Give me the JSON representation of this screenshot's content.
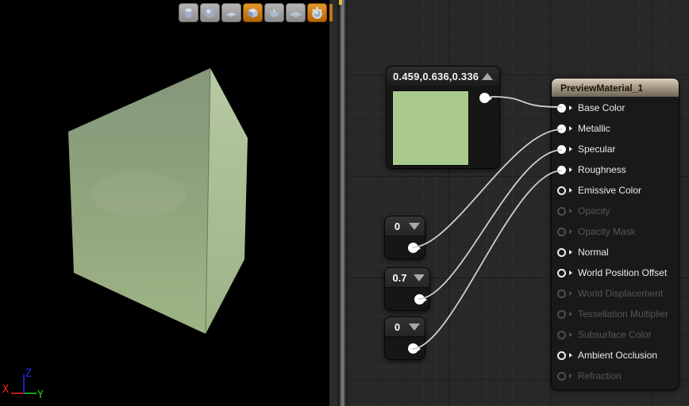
{
  "viewport": {
    "axis_labels": [
      "X",
      "Y",
      "Z"
    ],
    "toolbar": [
      {
        "name": "preview-cylinder-button",
        "icon": "cylinder",
        "active": false
      },
      {
        "name": "preview-sphere-button",
        "icon": "sphere",
        "active": false
      },
      {
        "name": "preview-plane-button",
        "icon": "plane",
        "active": false
      },
      {
        "name": "preview-cube-button",
        "icon": "cube",
        "active": true
      },
      {
        "name": "preview-teapot-button",
        "icon": "teapot",
        "active": false
      },
      {
        "name": "preview-grid-button",
        "icon": "grid",
        "active": false
      },
      {
        "name": "realtime-toggle-button",
        "icon": "stopwatch",
        "active": true
      }
    ]
  },
  "graph": {
    "constant3": {
      "title": "0.459,0.636,0.336"
    },
    "scalars": [
      {
        "value": "0"
      },
      {
        "value": "0.7"
      },
      {
        "value": "0"
      }
    ],
    "material": {
      "title": "PreviewMaterial_1",
      "pins": [
        {
          "label": "Base Color",
          "state": "connected"
        },
        {
          "label": "Metallic",
          "state": "connected"
        },
        {
          "label": "Specular",
          "state": "connected"
        },
        {
          "label": "Roughness",
          "state": "connected"
        },
        {
          "label": "Emissive Color",
          "state": "open"
        },
        {
          "label": "Opacity",
          "state": "disabled"
        },
        {
          "label": "Opacity Mask",
          "state": "disabled"
        },
        {
          "label": "Normal",
          "state": "open"
        },
        {
          "label": "World Position Offset",
          "state": "open"
        },
        {
          "label": "World Displacement",
          "state": "disabled"
        },
        {
          "label": "Tessellation Multiplier",
          "state": "disabled"
        },
        {
          "label": "Subsurface Color",
          "state": "disabled"
        },
        {
          "label": "Ambient Occlusion",
          "state": "open"
        },
        {
          "label": "Refraction",
          "state": "disabled"
        }
      ]
    },
    "connections": [
      {
        "from": "constant3",
        "to": "Base Color"
      },
      {
        "from": "scalar-0",
        "to": "Metallic"
      },
      {
        "from": "scalar-1",
        "to": "Specular"
      },
      {
        "from": "scalar-2",
        "to": "Roughness"
      }
    ]
  },
  "colors": {
    "accent_orange": "#c1731a",
    "swatch_green": "#a9c98d",
    "wire_gray": "#cfcfcf",
    "header_tan_top": "#dbcfba",
    "header_tan_bottom": "#6e6454",
    "axis_x_red": "#ff2020",
    "axis_y_green": "#22d822",
    "axis_z_blue": "#2a2aff",
    "preview_face_light": "#b7c9a2",
    "preview_face_dark": "#85977b"
  }
}
